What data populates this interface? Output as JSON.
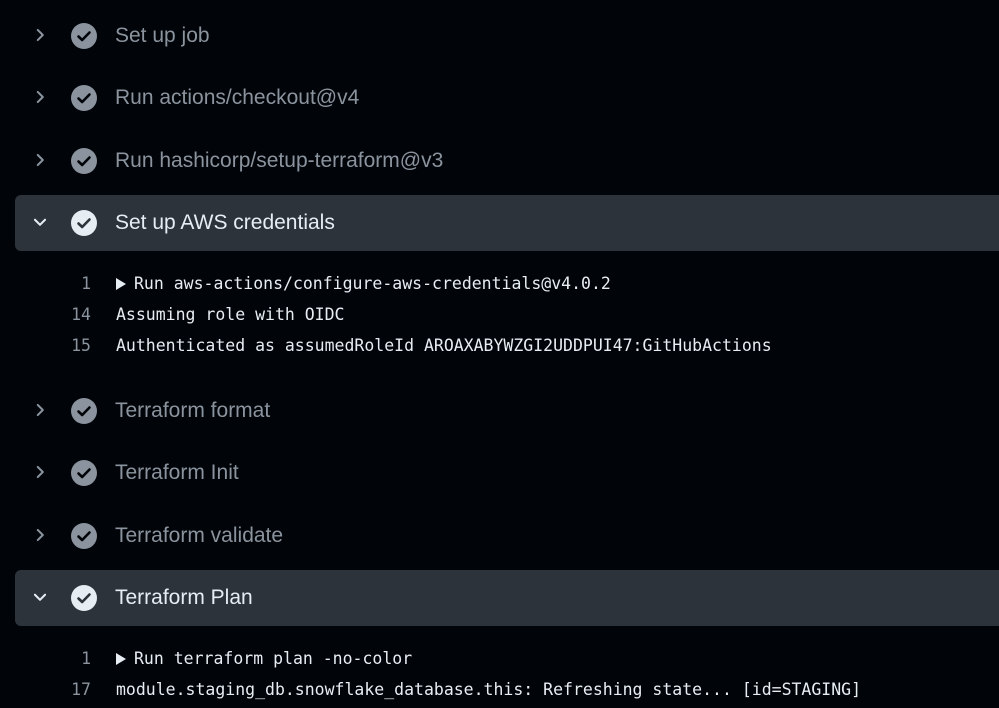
{
  "steps": [
    {
      "label": "Set up job",
      "expanded": false
    },
    {
      "label": "Run actions/checkout@v4",
      "expanded": false
    },
    {
      "label": "Run hashicorp/setup-terraform@v3",
      "expanded": false
    },
    {
      "label": "Set up AWS credentials",
      "expanded": true
    },
    {
      "label": "Terraform format",
      "expanded": false
    },
    {
      "label": "Terraform Init",
      "expanded": false
    },
    {
      "label": "Terraform validate",
      "expanded": false
    },
    {
      "label": "Terraform Plan",
      "expanded": true
    }
  ],
  "logs": {
    "aws_credentials": [
      {
        "num": "1",
        "text": "Run aws-actions/configure-aws-credentials@v4.0.2",
        "collapsible": true
      },
      {
        "num": "14",
        "text": "Assuming role with OIDC",
        "collapsible": false
      },
      {
        "num": "15",
        "text": "Authenticated as assumedRoleId AROAXABYWZGI2UDDPUI47:GitHubActions",
        "collapsible": false
      }
    ],
    "terraform_plan": [
      {
        "num": "1",
        "text": "Run terraform plan -no-color",
        "collapsible": true
      },
      {
        "num": "17",
        "text": "module.staging_db.snowflake_database.this: Refreshing state... [id=STAGING]",
        "collapsible": false
      }
    ]
  },
  "colors": {
    "background": "#010409",
    "expanded_header": "#2d333b",
    "check_icon": "#8b949e",
    "check_icon_active": "#e6edf3",
    "muted_text": "#8b949e",
    "text": "#e6edf3"
  },
  "icons": {
    "collapsed": "chevron-right-icon",
    "expanded": "chevron-down-icon",
    "status": "check-circle-icon",
    "log_group": "triangle-right-icon"
  }
}
